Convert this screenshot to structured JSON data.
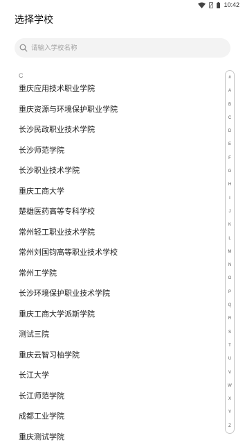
{
  "status_bar": {
    "time": "10:42"
  },
  "header": {
    "title": "选择学校"
  },
  "search": {
    "placeholder": "请输入学校名称",
    "icon": "search-icon"
  },
  "section": {
    "letter": "C"
  },
  "schools": [
    "重庆应用技术职业学院",
    "重庆资源与环境保护职业学院",
    "长沙民政职业技术学院",
    "长沙师范学院",
    "长沙职业技术学院",
    "重庆工商大学",
    "楚雄医药高等专科学校",
    "常州轻工职业技术学院",
    "常州刘国钧高等职业技术学校",
    "常州工学院",
    "长沙环境保护职业技术学院",
    "重庆工商大学派斯学院",
    "测试三院",
    "重庆云智习柚学院",
    "长江大学",
    "长江师范学院",
    "成都工业学院",
    "重庆测试学院"
  ],
  "alphabet": [
    "#",
    "A",
    "B",
    "C",
    "D",
    "E",
    "F",
    "G",
    "H",
    "I",
    "J",
    "K",
    "L",
    "M",
    "N",
    "O",
    "P",
    "Q",
    "R",
    "S",
    "T",
    "U",
    "V",
    "W",
    "X",
    "Y",
    "Z"
  ]
}
